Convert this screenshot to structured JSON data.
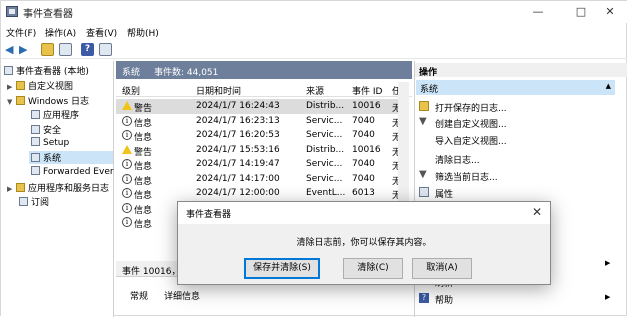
{
  "window": {
    "title": "事件查看器",
    "min": "—",
    "max": "□",
    "close": "✕"
  },
  "menu": [
    "文件(F)",
    "操作(A)",
    "查看(V)",
    "帮助(H)"
  ],
  "tree": {
    "root": "事件查看器 (本地)",
    "items": [
      "自定义视图",
      "Windows 日志",
      "应用程序",
      "安全",
      "Setup",
      "系统",
      "Forwarded Ever",
      "应用程序和服务日志",
      "订阅"
    ]
  },
  "center": {
    "log_name": "系统",
    "event_count": "事件数: 44,051",
    "columns": [
      "级别",
      "日期和时间",
      "来源",
      "事件 ID",
      "任"
    ],
    "rows": [
      {
        "level": "警告",
        "type": "warn",
        "date": "2024/1/7 16:24:43",
        "source": "Distrib...",
        "id": "10016",
        "task": "无"
      },
      {
        "level": "信息",
        "type": "info",
        "date": "2024/1/7 16:23:13",
        "source": "Servic...",
        "id": "7040",
        "task": "无"
      },
      {
        "level": "信息",
        "type": "info",
        "date": "2024/1/7 16:20:53",
        "source": "Servic...",
        "id": "7040",
        "task": "无"
      },
      {
        "level": "警告",
        "type": "warn",
        "date": "2024/1/7 15:53:16",
        "source": "Distrib...",
        "id": "10016",
        "task": "无"
      },
      {
        "level": "信息",
        "type": "info",
        "date": "2024/1/7 14:19:47",
        "source": "Servic...",
        "id": "7040",
        "task": "无"
      },
      {
        "level": "信息",
        "type": "info",
        "date": "2024/1/7 14:17:00",
        "source": "Servic...",
        "id": "7040",
        "task": "无"
      },
      {
        "level": "信息",
        "type": "info",
        "date": "2024/1/7 12:00:00",
        "source": "EventL...",
        "id": "6013",
        "task": "无"
      },
      {
        "level": "信息",
        "type": "info",
        "date": "",
        "source": "",
        "id": "",
        "task": ""
      },
      {
        "level": "信息",
        "type": "info",
        "date": "",
        "source": "",
        "id": "",
        "task": ""
      }
    ],
    "detail_title": "事件 10016，D",
    "tabs": [
      "常规",
      "详细信息"
    ]
  },
  "actions": {
    "header": "操作",
    "section": "系统",
    "items": [
      "打开保存的日志...",
      "创建自定义视图...",
      "导入自定义视图...",
      "清除日志...",
      "筛选当前日志...",
      "属性"
    ],
    "bottom_items": [
      "刷新",
      "帮助"
    ]
  },
  "dialog": {
    "title": "事件查看器",
    "message": "清除日志前，你可以保存其内容。",
    "buttons": {
      "save_clear": "保存并清除(S)",
      "clear": "清除(C)",
      "cancel": "取消(A)"
    }
  }
}
